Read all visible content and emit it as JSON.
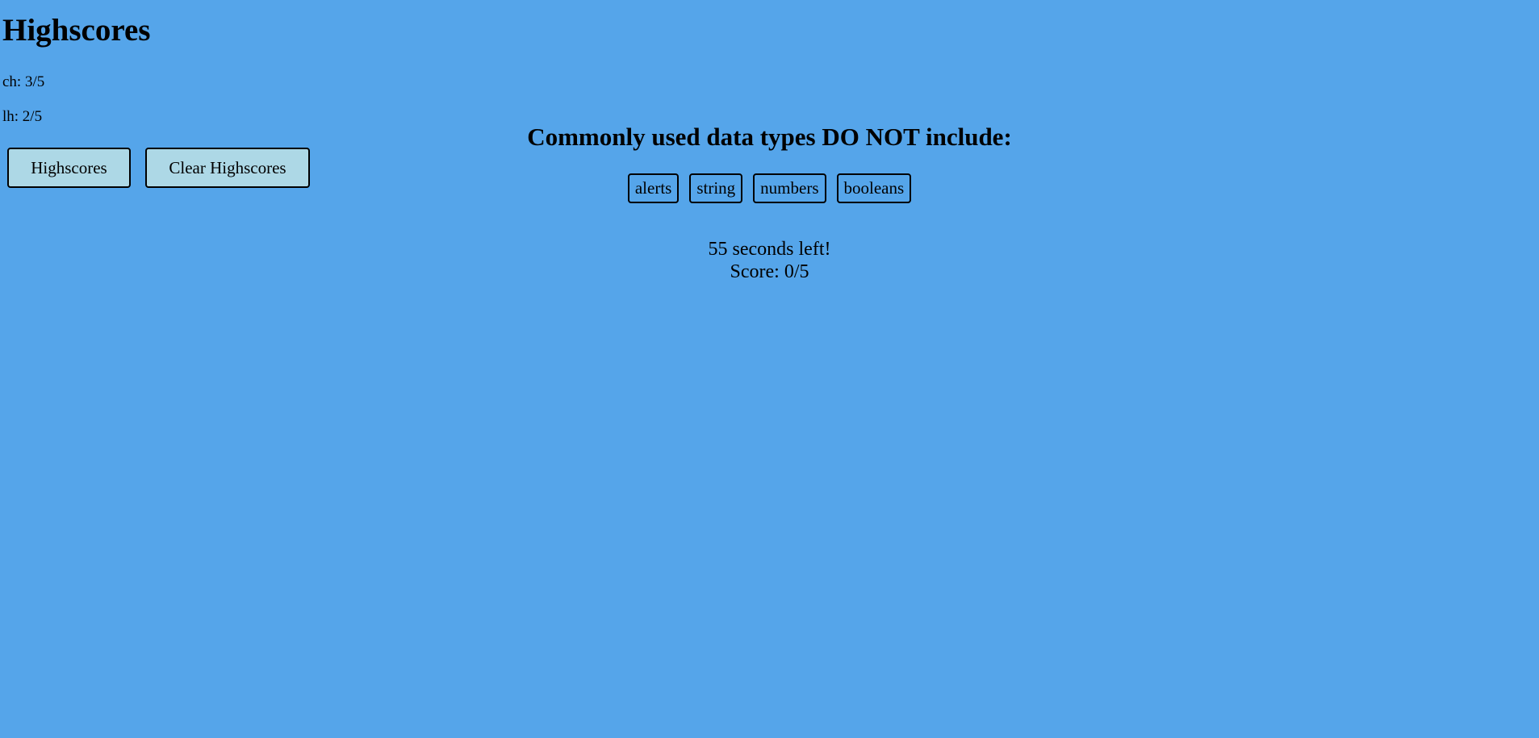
{
  "highscores": {
    "title": "Highscores",
    "entries": [
      {
        "text": "ch: 3/5"
      },
      {
        "text": "lh: 2/5"
      }
    ],
    "show_button_label": "Highscores",
    "clear_button_label": "Clear Highscores"
  },
  "quiz": {
    "question": "Commonly used data types DO NOT include:",
    "choices": [
      "alerts",
      "string",
      "numbers",
      "booleans"
    ],
    "timer_text": "55 seconds left!",
    "score_text": "Score: 0/5"
  },
  "colors": {
    "background": "#55a5ea",
    "button_fill": "#add8e6"
  }
}
